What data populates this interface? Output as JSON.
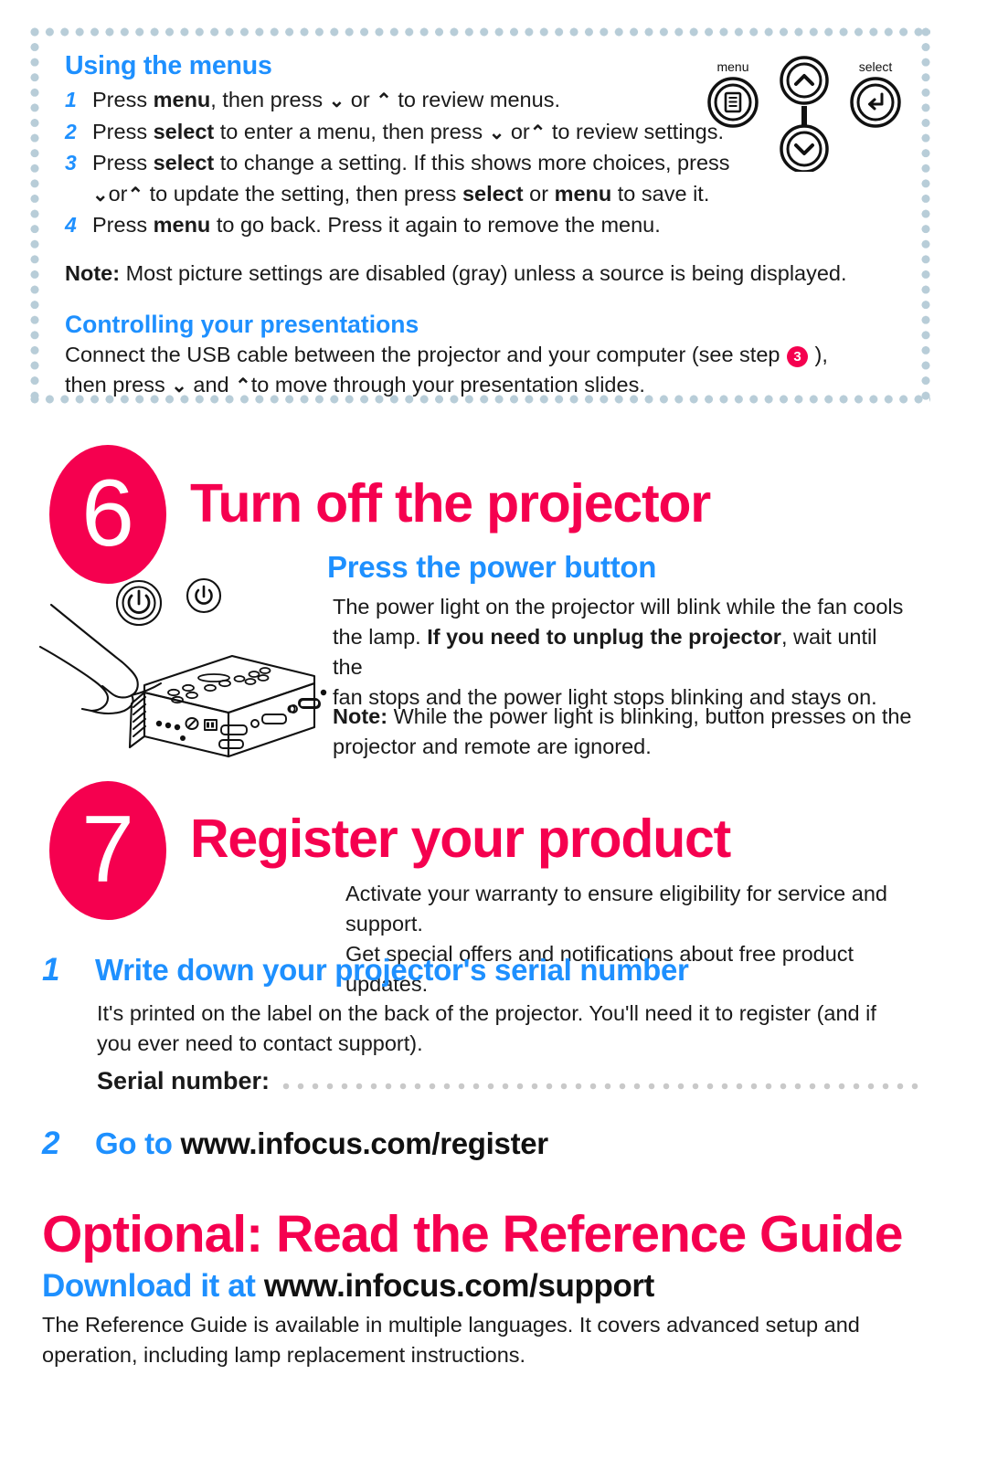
{
  "menu_box": {
    "heading": "Using the menus",
    "steps": [
      {
        "num": "1",
        "pre": "Press ",
        "b1": "menu",
        "mid": ", then press ",
        "chev1": "⌄",
        "mid2": " or ",
        "chev2": "⌃",
        "post": " to review menus."
      },
      {
        "num": "2",
        "pre": "Press ",
        "b1": "select",
        "mid": " to enter a menu, then press ",
        "chev1": "⌄",
        "mid2": " or",
        "chev2": "⌃",
        "post": " to review settings."
      },
      {
        "num": "3",
        "pre": "Press ",
        "b1": "select",
        "mid": " to change a setting. If this shows more choices, press",
        "chev1": "",
        "mid2": "",
        "chev2": "",
        "post": ""
      },
      {
        "num": "4",
        "pre": "Press ",
        "b1": "menu",
        "mid": " to go back. Press it again to remove the menu.",
        "chev1": "",
        "mid2": "",
        "chev2": "",
        "post": ""
      }
    ],
    "step3_cont": {
      "chev1": "⌄",
      "or": "or",
      "chev2": "⌃",
      "mid": " to update the setting, then press ",
      "b1": "select",
      "mid2": " or ",
      "b2": "menu",
      "post": " to save it."
    },
    "note_label": "Note:",
    "note_text": " Most picture settings are disabled (gray) unless a source is being displayed.",
    "controlling_heading": "Controlling your presentations",
    "controlling_line1_pre": "Connect the USB cable between the projector and your computer (see step ",
    "controlling_badge": "3",
    "controlling_line1_post": " ),",
    "controlling_line2_pre": "then press ",
    "controlling_chev1": "⌄",
    "controlling_line2_mid": " and ",
    "controlling_chev2": "⌃",
    "controlling_line2_post": "to move through your presentation slides.",
    "remote_labels": {
      "menu": "menu",
      "select": "select"
    }
  },
  "section_six": {
    "badge": "6",
    "title": "Turn off the projector",
    "subtitle": "Press the power button",
    "para1_a": "The power light on the projector will blink while the fan cools",
    "para1_b_pre": "the lamp. ",
    "para1_bold": "If you need to unplug the projector",
    "para1_b_post": ", wait until the",
    "para1_c": "fan stops and the power light stops blinking and stays on.",
    "note_label": "Note:",
    "note_line1": " While the power light is blinking, button presses on the",
    "note_line2": "projector and remote are ignored."
  },
  "section_seven": {
    "badge": "7",
    "title": "Register your product",
    "para_line1": "Activate your warranty to ensure eligibility for service and support.",
    "para_line2": "Get special offers and notifications about free product updates.",
    "step1_num": "1",
    "step1_head": "Write down your projector's serial number",
    "step1_body_line1": "It's printed on the label on the back of the projector. You'll need it to register (and if",
    "step1_body_line2": "you ever need to contact support).",
    "serial_label": "Serial number:",
    "step2_num": "2",
    "step2_head_blue": "Go to ",
    "step2_head_url": "www.infocus.com/register"
  },
  "optional": {
    "title": "Optional: Read the Reference Guide",
    "download_blue": "Download it at ",
    "download_url": "www.infocus.com/support",
    "body_line1": "The Reference Guide is available in multiple languages. It covers advanced setup and",
    "body_line2": "operation, including lamp replacement instructions."
  },
  "colors": {
    "accent_magenta": "#f5004f",
    "accent_blue": "#1e90ff",
    "dot_border": "#b8cdd8",
    "text": "#1a1a1a"
  }
}
